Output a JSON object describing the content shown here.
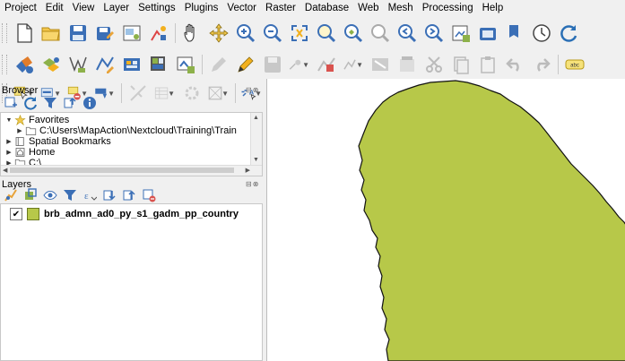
{
  "menu": [
    "Project",
    "Edit",
    "View",
    "Layer",
    "Settings",
    "Plugins",
    "Vector",
    "Raster",
    "Database",
    "Web",
    "Mesh",
    "Processing",
    "Help"
  ],
  "browser_panel": {
    "title": "Browser",
    "controls": "⊟⊗",
    "items": [
      {
        "label": "Favorites",
        "arrow": "▼"
      },
      {
        "label": "C:\\Users\\MapAction\\Nextcloud\\Training\\Train",
        "arrow": "▶"
      },
      {
        "label": "Spatial Bookmarks",
        "arrow": "▶"
      },
      {
        "label": "Home",
        "arrow": "▶"
      },
      {
        "label": "C:\\",
        "arrow": "▶"
      }
    ]
  },
  "layers_panel": {
    "title": "Layers",
    "controls": "⊟⊗",
    "layer": {
      "name": "brb_admn_ad0_py_s1_gadm_pp_country",
      "checked": "✔",
      "swatch_color": "#b7c849"
    }
  },
  "map": {
    "fill_color": "#b7c849",
    "stroke_color": "#111111",
    "background": "#ffffff"
  },
  "colors": {
    "accent_blue": "#2a6fb5",
    "toolbar_bg": "#f0f0f0"
  },
  "icons": {
    "toolbar1": [
      "new-project-icon",
      "open-project-icon",
      "save-project-icon",
      "save-as-icon",
      "print-layout-icon",
      "style-manager-icon",
      "pan-icon",
      "pan-to-selection-icon",
      "zoom-in-icon",
      "zoom-out-icon",
      "zoom-full-icon",
      "zoom-to-selection-icon",
      "zoom-to-layer-icon",
      "zoom-native-icon",
      "zoom-last-icon",
      "zoom-next-icon",
      "new-bookmark-icon",
      "show-bookmarks-icon",
      "new-map-view-icon",
      "temporal-controller-icon",
      "refresh-icon"
    ],
    "toolbar2": [
      "data-source-manager-icon",
      "add-vector-layer-icon",
      "add-raster-layer-icon",
      "digitize-icon",
      "new-geopackage-icon",
      "new-shapefile-icon",
      "new-spatialite-icon",
      "toggle-editing-icon",
      "pencil-icon",
      "save-edits-icon",
      "add-feature-icon",
      "vertex-tool-icon",
      "delete-feature-icon",
      "cut-features-icon",
      "copy-features-icon",
      "paste-features-icon",
      "undo-icon",
      "redo-icon",
      "label-toolbar-icon"
    ],
    "toolbar3": [
      "select-features-icon",
      "select-by-value-icon",
      "deselect-icon",
      "field-calculator-icon",
      "statistics-icon",
      "attribute-table-icon",
      "processing-toolbox-icon",
      "measure-icon",
      "identify-icon",
      "new-3d-view-icon",
      "map-tips-icon",
      "text-annotation-icon",
      "share-icon",
      "kml-export-icon",
      "kmz-export-icon"
    ]
  }
}
